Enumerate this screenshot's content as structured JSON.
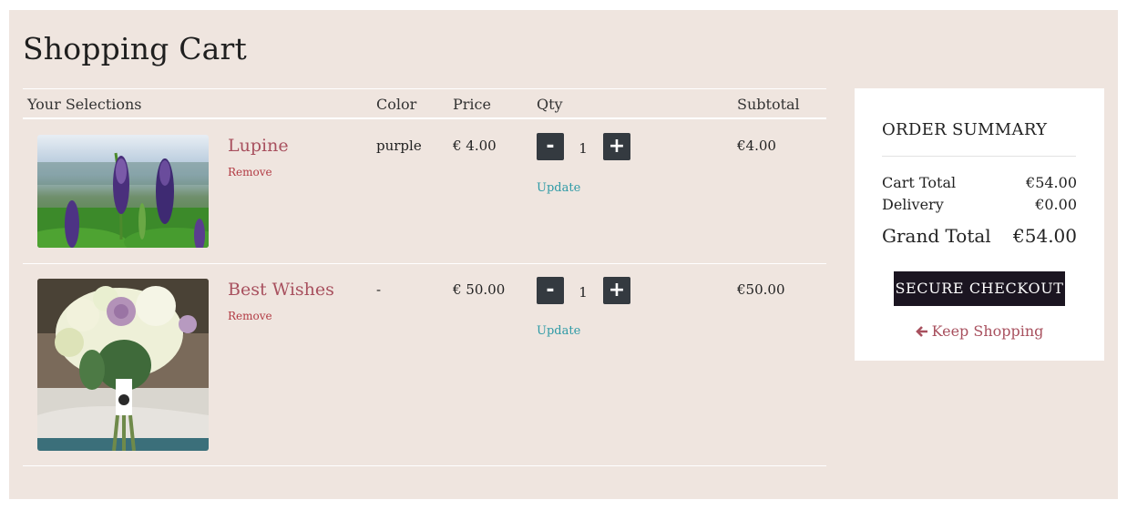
{
  "page": {
    "title": "Shopping Cart"
  },
  "table": {
    "headers": {
      "selections": "Your Selections",
      "color": "Color",
      "price": "Price",
      "qty": "Qty",
      "subtotal": "Subtotal"
    },
    "items": [
      {
        "name": "Lupine",
        "remove_label": "Remove",
        "color": "purple",
        "price": "€ 4.00",
        "qty": "1",
        "minus_label": "-",
        "plus_label": "+",
        "update_label": "Update",
        "subtotal": "€4.00"
      },
      {
        "name": "Best Wishes",
        "remove_label": "Remove",
        "color": "-",
        "price": "€ 50.00",
        "qty": "1",
        "minus_label": "-",
        "plus_label": "+",
        "update_label": "Update",
        "subtotal": "€50.00"
      }
    ]
  },
  "summary": {
    "title": "ORDER SUMMARY",
    "cart_total_label": "Cart Total",
    "cart_total_value": "€54.00",
    "delivery_label": "Delivery",
    "delivery_value": "€0.00",
    "grand_total_label": "Grand Total",
    "grand_total_value": "€54.00",
    "checkout_label": "SECURE CHECKOUT",
    "keep_shopping_label": "Keep Shopping"
  },
  "colors": {
    "panel_bg": "#efe5df",
    "accent": "#a8505e",
    "checkout_bg": "#1b1521",
    "update_link": "#2e9aa6",
    "qty_button": "#343a40"
  },
  "icons": [
    "arrow-left-icon"
  ]
}
